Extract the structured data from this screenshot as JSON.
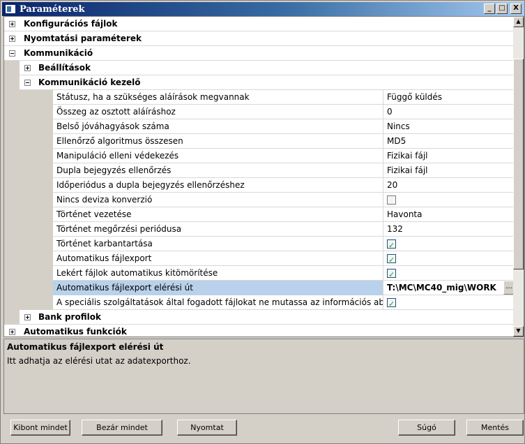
{
  "window": {
    "title": "Paraméterek",
    "buttons": {
      "minimize": "_",
      "maximize": "□",
      "close": "X"
    }
  },
  "tree": {
    "categories": {
      "config_files": "Konfigurációs fájlok",
      "print_params": "Nyomtatási paraméterek",
      "communication": "Kommunikáció",
      "settings": "Beállítások",
      "comm_handler": "Kommunikáció kezelő",
      "bank_profiles": "Bank profilok",
      "auto_functions": "Automatikus funkciók"
    },
    "properties": [
      {
        "name": "Státusz, ha a szükséges aláírások megvannak",
        "value": "Függő küldés"
      },
      {
        "name": "Összeg az osztott aláíráshoz",
        "value": "0"
      },
      {
        "name": "Belső jóváhagyások száma",
        "value": "Nincs"
      },
      {
        "name": "Ellenőrző algoritmus összesen",
        "value": "MD5"
      },
      {
        "name": "Manipuláció elleni védekezés",
        "value": "Fizikai fájl"
      },
      {
        "name": "Dupla bejegyzés ellenőrzés",
        "value": "Fizikai fájl"
      },
      {
        "name": "Időperiódus a dupla bejegyzés ellenőrzéshez",
        "value": "20"
      },
      {
        "name": "Nincs deviza konverzió",
        "value": ""
      },
      {
        "name": "Történet vezetése",
        "value": "Havonta"
      },
      {
        "name": "Történet megőrzési periódusa",
        "value": "132"
      },
      {
        "name": "Történet karbantartása",
        "value": ""
      },
      {
        "name": "Automatikus fájlexport",
        "value": ""
      },
      {
        "name": "Lekért fájlok automatikus kitömörítése",
        "value": ""
      },
      {
        "name": "Automatikus fájlexport elérési út",
        "value": "T:\\MC\\MC40_mig\\WORK"
      },
      {
        "name": "A speciális szolgáltatások által fogadott fájlokat ne mutassa az információs abl...",
        "value": ""
      }
    ],
    "ellipsis": "..."
  },
  "description": {
    "title": "Automatikus fájlexport elérési út",
    "text": "Itt adhatja az elérési utat az adatexporthoz."
  },
  "buttons": {
    "expand_all": "Kibont mindet",
    "collapse_all": "Bezár mindet",
    "print": "Nyomtat",
    "help": "Súgó",
    "save": "Mentés"
  },
  "scrollbar": {
    "up": "▲",
    "down": "▼"
  }
}
